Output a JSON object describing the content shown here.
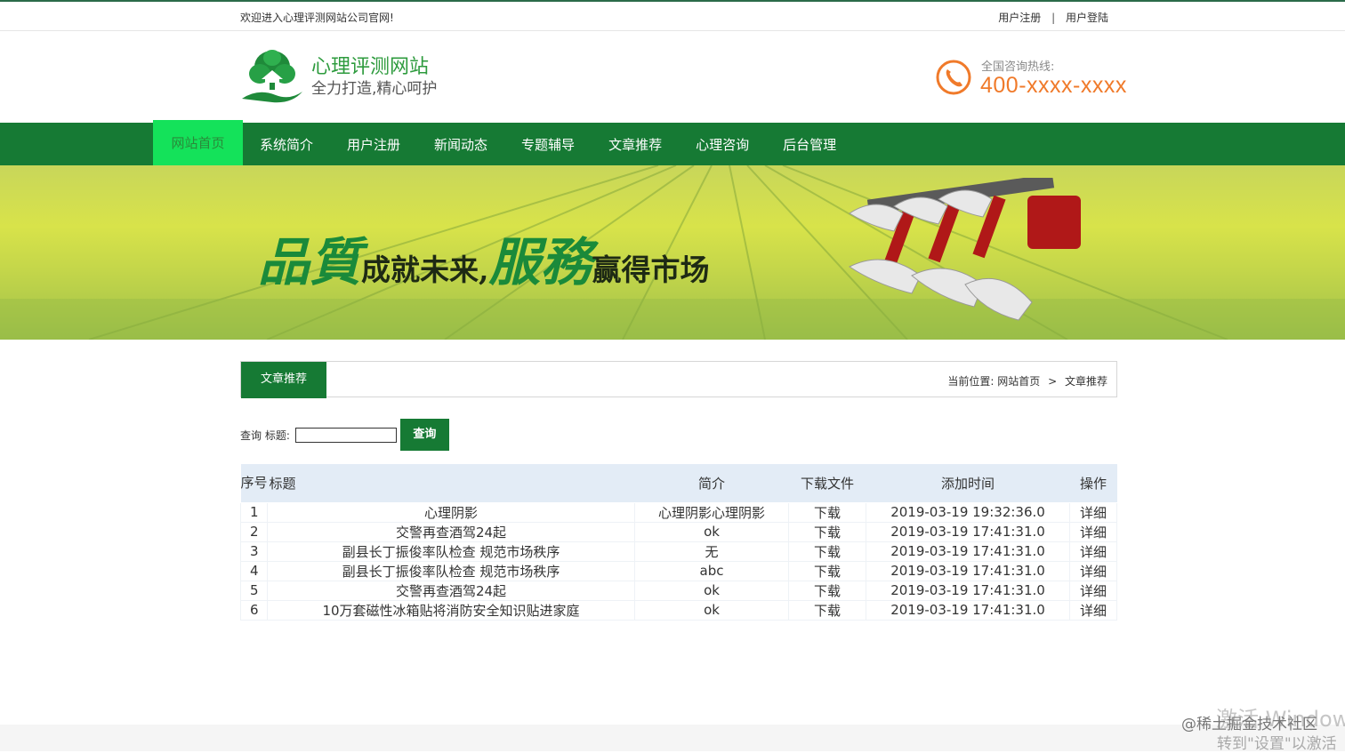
{
  "topbar": {
    "welcome": "欢迎进入心理评测网站公司官网!",
    "register": "用户注册",
    "separator": "|",
    "login": "用户登陆"
  },
  "header": {
    "title": "心理评测网站",
    "slogan": "全力打造,精心呵护",
    "hotline_label": "全国咨询热线:",
    "hotline_number": "400-xxxx-xxxx"
  },
  "nav": {
    "items": [
      {
        "label": "网站首页"
      },
      {
        "label": "系统简介"
      },
      {
        "label": "用户注册"
      },
      {
        "label": "新闻动态"
      },
      {
        "label": "专题辅导"
      },
      {
        "label": "文章推荐"
      },
      {
        "label": "心理咨询"
      },
      {
        "label": "后台管理"
      }
    ]
  },
  "banner": {
    "big1": "品質",
    "small1": "成就未来,",
    "big2": "服務",
    "small2": "赢得市场"
  },
  "section": {
    "tab": "文章推荐",
    "crumb_prefix": "当前位置:",
    "crumb_home": "网站首页",
    "crumb_arrow": ">",
    "crumb_current": "文章推荐"
  },
  "search": {
    "label": "查询 标题:",
    "value": "",
    "button": "查询"
  },
  "table": {
    "headers": {
      "num": "序号",
      "title": "标题",
      "intro": "简介",
      "file": "下载文件",
      "time": "添加时间",
      "op": "操作"
    },
    "rows": [
      {
        "num": "1",
        "title": "心理阴影",
        "intro": "心理阴影心理阴影",
        "file": "下载",
        "time": "2019-03-19 19:32:36.0",
        "op": "详细"
      },
      {
        "num": "2",
        "title": "交警再查酒驾24起",
        "intro": "ok",
        "file": "下载",
        "time": "2019-03-19 17:41:31.0",
        "op": "详细"
      },
      {
        "num": "3",
        "title": "副县长丁振俊率队检查 规范市场秩序",
        "intro": "无",
        "file": "下载",
        "time": "2019-03-19 17:41:31.0",
        "op": "详细"
      },
      {
        "num": "4",
        "title": "副县长丁振俊率队检查 规范市场秩序",
        "intro": "abc",
        "file": "下载",
        "time": "2019-03-19 17:41:31.0",
        "op": "详细"
      },
      {
        "num": "5",
        "title": "交警再查酒驾24起",
        "intro": "ok",
        "file": "下载",
        "time": "2019-03-19 17:41:31.0",
        "op": "详细"
      },
      {
        "num": "6",
        "title": "10万套磁性冰箱贴将消防安全知识贴进家庭",
        "intro": "ok",
        "file": "下载",
        "time": "2019-03-19 17:41:31.0",
        "op": "详细"
      }
    ]
  },
  "overlay": {
    "watermark": "@稀土掘金技术社区",
    "activate_line1": "激活 Window",
    "activate_line2": "转到\"设置\"以激活"
  },
  "colors": {
    "nav_bg": "#167a34",
    "nav_active": "#14e25a",
    "title_green": "#2e9b3e",
    "hotline_orange": "#f07a2a",
    "table_header_bg": "#e3ecf6"
  }
}
